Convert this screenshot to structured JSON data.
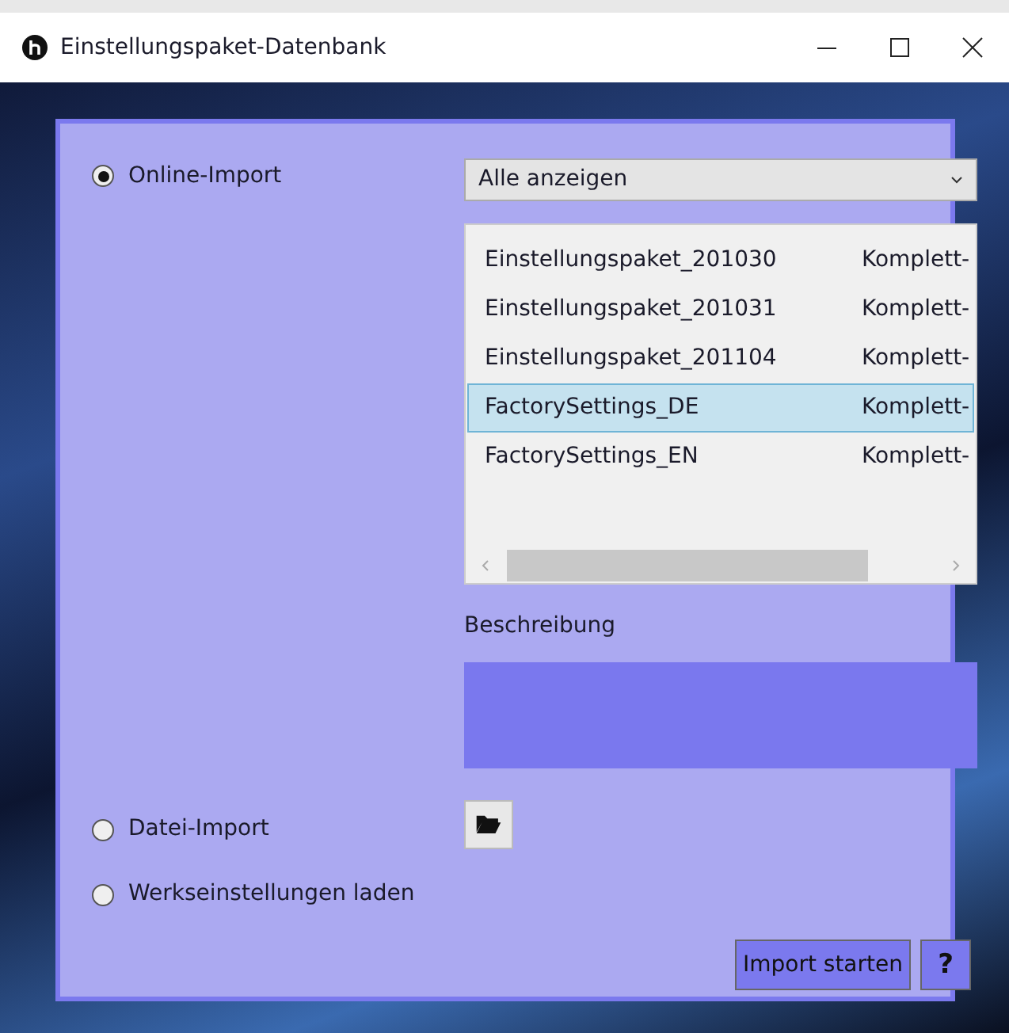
{
  "window": {
    "title": "Einstellungspaket-Datenbank"
  },
  "import_options": [
    {
      "label": "Online-Import",
      "selected": true
    },
    {
      "label": "Datei-Import",
      "selected": false
    },
    {
      "label": "Werkseinstellungen laden",
      "selected": false
    }
  ],
  "filter": {
    "value": "Alle anzeigen"
  },
  "packages": [
    {
      "name": "Einstellungspaket_201030",
      "type": "Komplett-",
      "selected": false
    },
    {
      "name": "Einstellungspaket_201031",
      "type": "Komplett-",
      "selected": false
    },
    {
      "name": "Einstellungspaket_201104",
      "type": "Komplett-",
      "selected": false
    },
    {
      "name": "FactorySettings_DE",
      "type": "Komplett-",
      "selected": true
    },
    {
      "name": "FactorySettings_EN",
      "type": "Komplett-",
      "selected": false
    }
  ],
  "description": {
    "label": "Beschreibung"
  },
  "buttons": {
    "start": "Import starten",
    "help": "?"
  }
}
